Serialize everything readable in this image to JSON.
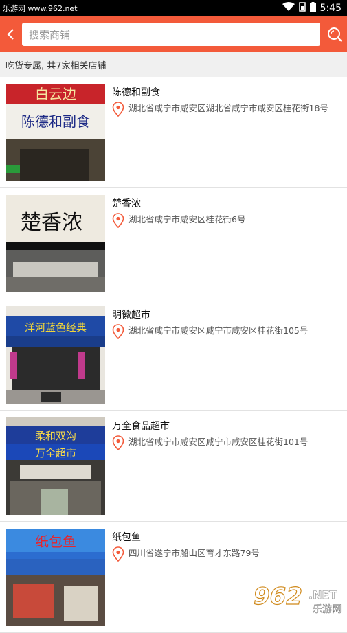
{
  "status_bar": {
    "left_text": "乐游网 www.962.net",
    "time": "5:45"
  },
  "header": {
    "search_placeholder": "搜索商铺"
  },
  "summary": "吃货专属, 共7家相关店铺",
  "shops": [
    {
      "name": "陈德和副食",
      "address": "湖北省咸宁市咸安区湖北省咸宁市咸安区桂花街18号",
      "sign_text": "白云边",
      "sign_sub": "陈德和副食"
    },
    {
      "name": "楚香浓",
      "address": "湖北省咸宁市咸安区桂花街6号",
      "sign_text": "楚香浓"
    },
    {
      "name": "明徽超市",
      "address": "湖北省咸宁市咸安区咸宁市咸安区桂花街105号",
      "sign_text": "洋河蓝色经典"
    },
    {
      "name": "万全食品超市",
      "address": "湖北省咸宁市咸安区咸宁市咸安区桂花街101号",
      "sign_text": "柔和双沟",
      "sign_sub": "万全超市"
    },
    {
      "name": "纸包鱼",
      "address": "四川省遂宁市船山区育才东路79号",
      "sign_text": "纸包鱼"
    }
  ],
  "watermark": {
    "big": "962",
    "small": ".NET",
    "sub": "乐游网"
  },
  "colors": {
    "accent": "#f35a3a",
    "pin": "#f35a3a"
  }
}
